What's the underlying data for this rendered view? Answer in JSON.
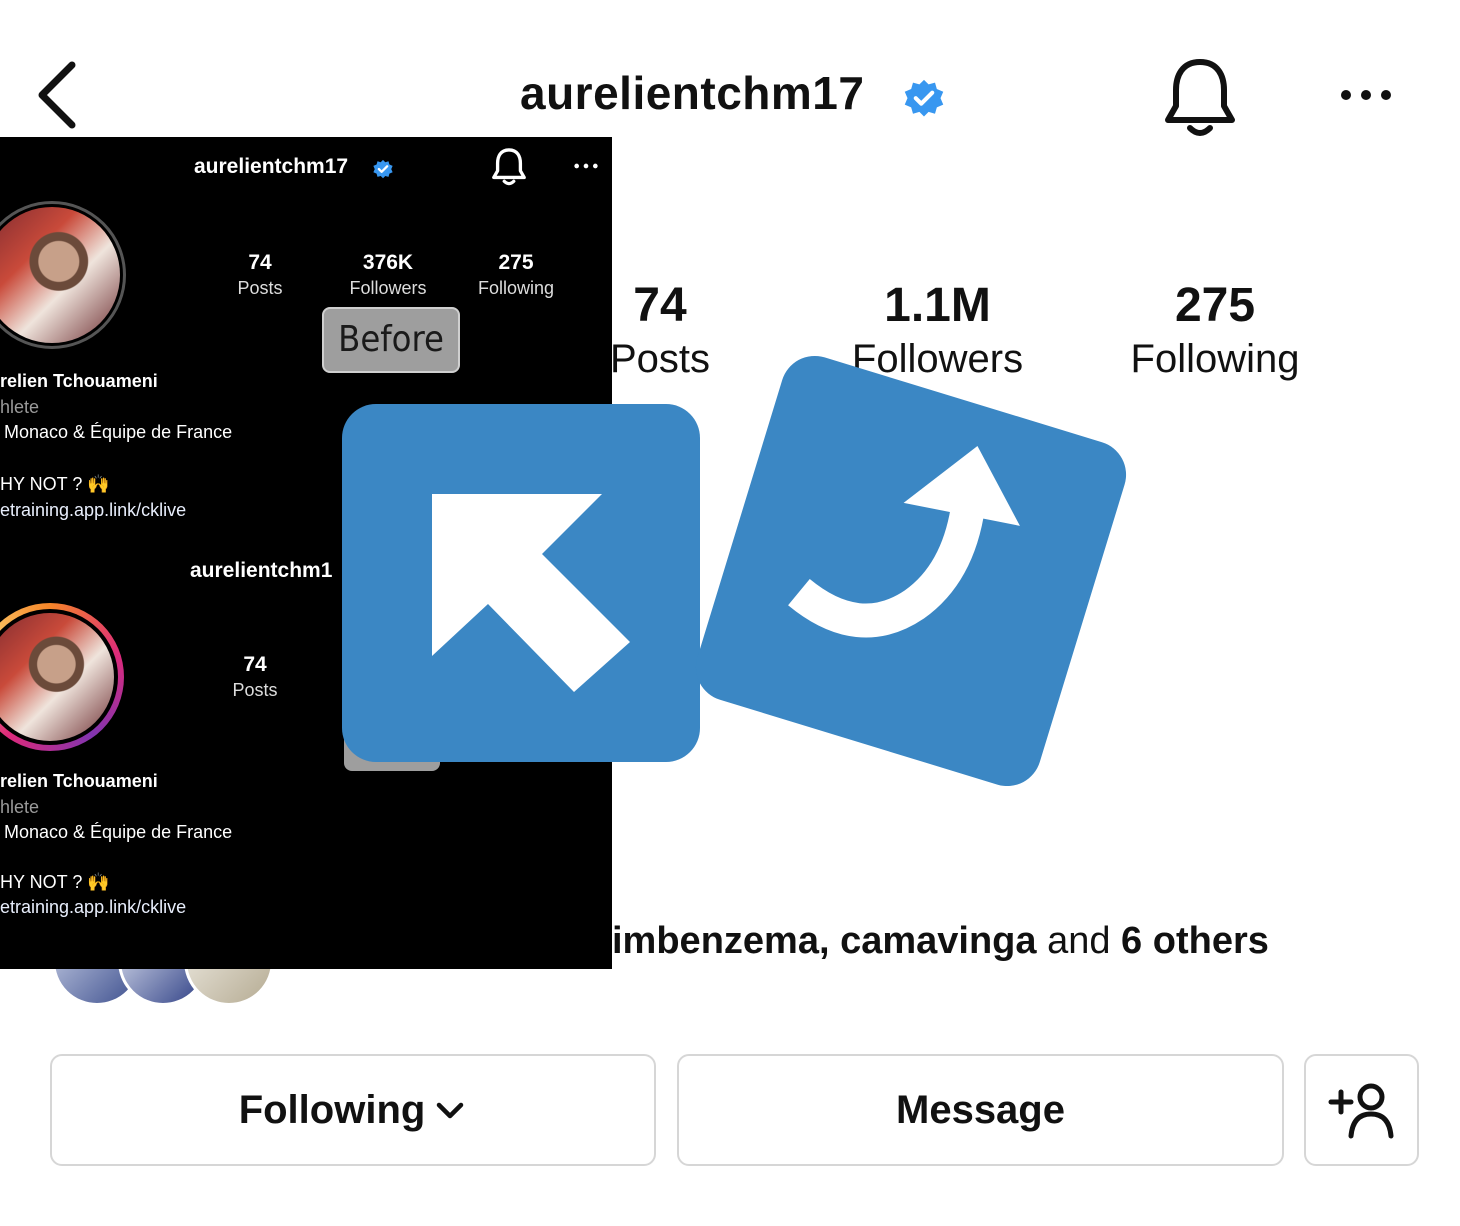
{
  "header": {
    "username": "aurelientchm17"
  },
  "stats": [
    {
      "value": "74",
      "label": "Posts"
    },
    {
      "value": "1.1M",
      "label": "Followers"
    },
    {
      "value": "275",
      "label": "Following"
    }
  ],
  "mutual": {
    "names": "imbenzema, camavinga",
    "joiner": " and ",
    "others": "6 others"
  },
  "actions": {
    "following_label": "Following",
    "message_label": "Message"
  },
  "inset": {
    "username": "aurelientchm17",
    "username_partial": "aurelientchm1",
    "stats": [
      {
        "value": "74",
        "label": "Posts"
      },
      {
        "value": "376K",
        "label": "Followers"
      },
      {
        "value": "275",
        "label": "Following"
      }
    ],
    "badge": "Before",
    "bio_name": "relien Tchouameni",
    "bio_category": "hlete",
    "bio_clubs": "Monaco & Équipe de France",
    "bio_quote": "HY NOT ? 🙌",
    "bio_link": "etraining.app.link/cklive",
    "second_posts_value": "74",
    "second_posts_label": "Posts"
  },
  "colors": {
    "verified": "#3897f0",
    "tile": "#3b87c4",
    "story_ring": "#d62976"
  },
  "icons": [
    "back-icon",
    "verified-icon",
    "bell-icon",
    "more-icon",
    "add-person-icon",
    "chevron-down-icon",
    "arrow-up-left-icon",
    "curved-arrow-up-icon"
  ]
}
